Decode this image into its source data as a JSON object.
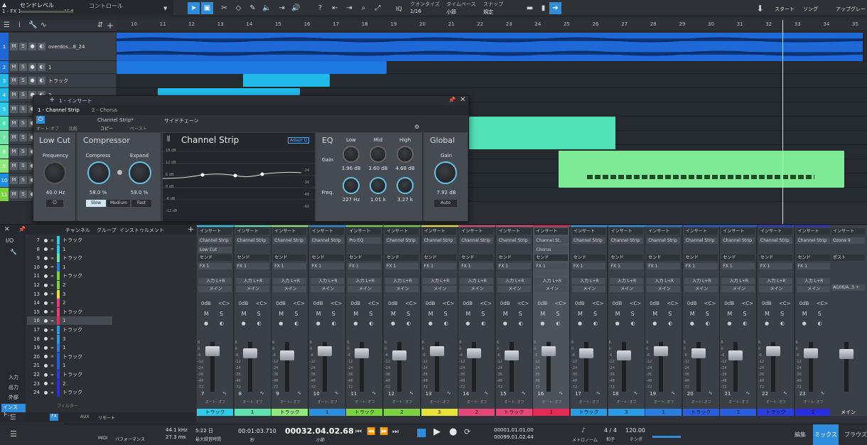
{
  "topbar": {
    "send_level": "センドレベル",
    "fx": "1 - FX 1",
    "db": "-15.8",
    "control": "コントロール",
    "quantize_label": "クオンタイズ",
    "quantize_value": "1/16",
    "timebase_label": "タイムベース",
    "timebase_value": "小節",
    "snap_label": "スナップ",
    "snap_value": "規定",
    "iq": "IQ",
    "start": "スタート",
    "song": "ソング",
    "upgrade": "アップグレード"
  },
  "ruler": {
    "ticks": [
      "10",
      "11",
      "12",
      "13",
      "14",
      "15",
      "16",
      "17",
      "18",
      "19",
      "20",
      "21",
      "22",
      "23",
      "24",
      "25",
      "26",
      "27",
      "28",
      "29",
      "30",
      "31",
      "32",
      "33",
      "34",
      "35"
    ]
  },
  "tracks": [
    {
      "num": "1",
      "name": "overdos...8_24",
      "input": "入力 L+R"
    },
    {
      "num": "2",
      "name": "1"
    },
    {
      "num": "3",
      "name": "トラック"
    },
    {
      "num": "4",
      "name": "2"
    },
    {
      "num": "5",
      "name": ""
    },
    {
      "num": "6",
      "name": ""
    },
    {
      "num": "7",
      "name": ""
    },
    {
      "num": "8",
      "name": ""
    },
    {
      "num": "9",
      "name": ""
    },
    {
      "num": "10",
      "name": ""
    },
    {
      "num": "11",
      "name": ""
    }
  ],
  "plugin": {
    "insert_label": "1 - インサート",
    "preset_tab1": "1 - Channel Strip",
    "preset_tab2": "2 - Chorus",
    "preset_name": "Channel Strip*",
    "sidechain": "サイドチェーン",
    "auto": "オート:オフ",
    "compare": "比較",
    "copy": "コピー",
    "paste": "ペースト",
    "title": "Channel Strip",
    "adapt": "Adapt Q",
    "lowcut": {
      "title": "Low Cut",
      "freq_label": "Frequency",
      "freq_value": "40.0 Hz"
    },
    "comp": {
      "title": "Compressor",
      "comp_label": "Compress",
      "comp_value": "58.0 %",
      "exp_label": "Expand",
      "exp_value": "53.0 %",
      "modes": [
        "Slow",
        "Medium",
        "Fast"
      ]
    },
    "eq": {
      "title": "EQ",
      "gain_label": "Gain",
      "freq_label": "Freq.",
      "bands": [
        "Low",
        "Mid",
        "High"
      ],
      "gains": [
        "3.96 dB",
        "3.60 dB",
        "4.68 dB"
      ],
      "freqs": [
        "227 Hz",
        "1.01 k",
        "3.27 k"
      ]
    },
    "global": {
      "title": "Global",
      "gain_label": "Gain",
      "gain_value": "7.92 dB",
      "auto": "Auto"
    },
    "db_scale": [
      "18 dB",
      "12 dB",
      "6 dB",
      "0 dB",
      "-6 dB",
      "-12 dB"
    ],
    "meter_scale": [
      "-24",
      "-36",
      "-48",
      "-60"
    ]
  },
  "left_panel": {
    "channel_hdr": "チャンネル",
    "group_hdr": "グループ",
    "instrument_hdr": "インストゥルメント",
    "io": "I/O",
    "input": "入力",
    "output": "出力",
    "external": "外部",
    "instrument": "インスト...",
    "filter": "フィルター",
    "remote": "リモート",
    "fx": "FX",
    "fx_ch": "FX",
    "aux": "AUX",
    "rows": [
      {
        "n": "7",
        "name": "トラック",
        "color": "#2ecbe8"
      },
      {
        "n": "8",
        "name": "1",
        "color": "#2ecbe8"
      },
      {
        "n": "9",
        "name": "トラック",
        "color": "#6fe2a6"
      },
      {
        "n": "10",
        "name": "1",
        "color": "#2b7fe0"
      },
      {
        "n": "11",
        "name": "トラック",
        "color": "#7ad33f"
      },
      {
        "n": "12",
        "name": "2",
        "color": "#7ad33f"
      },
      {
        "n": "13",
        "name": "3",
        "color": "#e6e23a"
      },
      {
        "n": "14",
        "name": "2",
        "color": "#e63d78"
      },
      {
        "n": "15",
        "name": "トラック",
        "color": "#e63d78"
      },
      {
        "n": "16",
        "name": "1",
        "color": "#e62a55"
      },
      {
        "n": "17",
        "name": "トラック",
        "color": "#2a9be6"
      },
      {
        "n": "18",
        "name": "3",
        "color": "#2a9be6"
      },
      {
        "n": "19",
        "name": "1",
        "color": "#2a7ee0"
      },
      {
        "n": "20",
        "name": "トラック",
        "color": "#2a5ee0"
      },
      {
        "n": "21",
        "name": "1",
        "color": "#2a5ee0"
      },
      {
        "n": "22",
        "name": "トラック",
        "color": "#2a3ee0"
      },
      {
        "n": "23",
        "name": "2",
        "color": "#2a2ee0"
      },
      {
        "n": "24",
        "name": "トラック",
        "color": "#2a2ee0"
      }
    ]
  },
  "mixer": {
    "insert": "インサート",
    "send": "センド",
    "post": "ポスト",
    "fx1": "FX 1",
    "input_lr": "入力 L+R",
    "main": "メイン",
    "zero_db": "0dB",
    "center": "<C>",
    "auto": "オート: オフ",
    "master_out": "AG06/A..3 +",
    "master_plugin": "Ozone 9",
    "master_name": "メイン",
    "channels": [
      {
        "n": "7",
        "plugin": "Channel Strip",
        "plugin2": "Low Cut",
        "name": "トラック",
        "color": "#2ecbe8"
      },
      {
        "n": "8",
        "plugin": "Channel Strip",
        "name": "1",
        "color": "#5fe0b0"
      },
      {
        "n": "9",
        "plugin": "Channel Strip",
        "name": "トラック",
        "color": "#8fe87a"
      },
      {
        "n": "10",
        "plugin": "Channel Strip",
        "name": "1",
        "color": "#2b8fe0"
      },
      {
        "n": "11",
        "plugin": "Pro EQ",
        "name": "トラック",
        "color": "#7ad33f"
      },
      {
        "n": "12",
        "plugin": "Channel Strip",
        "name": "2",
        "color": "#7ad33f"
      },
      {
        "n": "13",
        "plugin": "Channel Strip",
        "name": "3",
        "color": "#e6e23a"
      },
      {
        "n": "14",
        "plugin": "Channel Strip",
        "name": "2",
        "color": "#e6477a"
      },
      {
        "n": "15",
        "plugin": "Channel Strip",
        "name": "トラック",
        "color": "#e6477a"
      },
      {
        "n": "16",
        "plugin": "Channel St..",
        "plugin2": "Chorus",
        "name": "1",
        "color": "#e62a55"
      },
      {
        "n": "17",
        "plugin": "Channel Strip",
        "name": "トラック",
        "color": "#2a9be6"
      },
      {
        "n": "18",
        "plugin": "Channel Strip",
        "name": "3",
        "color": "#2a9be6"
      },
      {
        "n": "19",
        "plugin": "Channel Strip",
        "name": "1",
        "color": "#2a7ee0"
      },
      {
        "n": "20",
        "plugin": "Channel Strip",
        "name": "トラック",
        "color": "#2a5ee0"
      },
      {
        "n": "21",
        "plugin": "Channel Strip",
        "name": "1",
        "color": "#2a5ee0"
      },
      {
        "n": "22",
        "plugin": "Channel Strip",
        "name": "トラック",
        "color": "#2a3ee0"
      },
      {
        "n": "23",
        "plugin": "Channel Strip",
        "name": "2",
        "color": "#2a2ee0"
      }
    ],
    "fader_scale": [
      "6",
      "0",
      "-6",
      "-12",
      "-24",
      "-36",
      "-48",
      "-72"
    ]
  },
  "transport": {
    "midi": "MIDI",
    "performance": "パフォーマンス",
    "rate": "44.1 kHz",
    "latency": "27.3 ms",
    "date": "5:22 日",
    "max_rec": "最大録音時間",
    "time": "00:01:03.710",
    "time_unit": "秒",
    "bars": "00032.04.02.68",
    "bars_unit": "小節",
    "loop_l": "00001.01.01.00",
    "loop_r": "00099.01.02.44",
    "sig": "4 / 4",
    "sig_label": "拍子",
    "tempo": "120.00",
    "tempo_label": "テンポ",
    "metronome": "メトロノーム",
    "edit": "編集",
    "mix": "ミックス",
    "browse": "ブラウズ"
  }
}
